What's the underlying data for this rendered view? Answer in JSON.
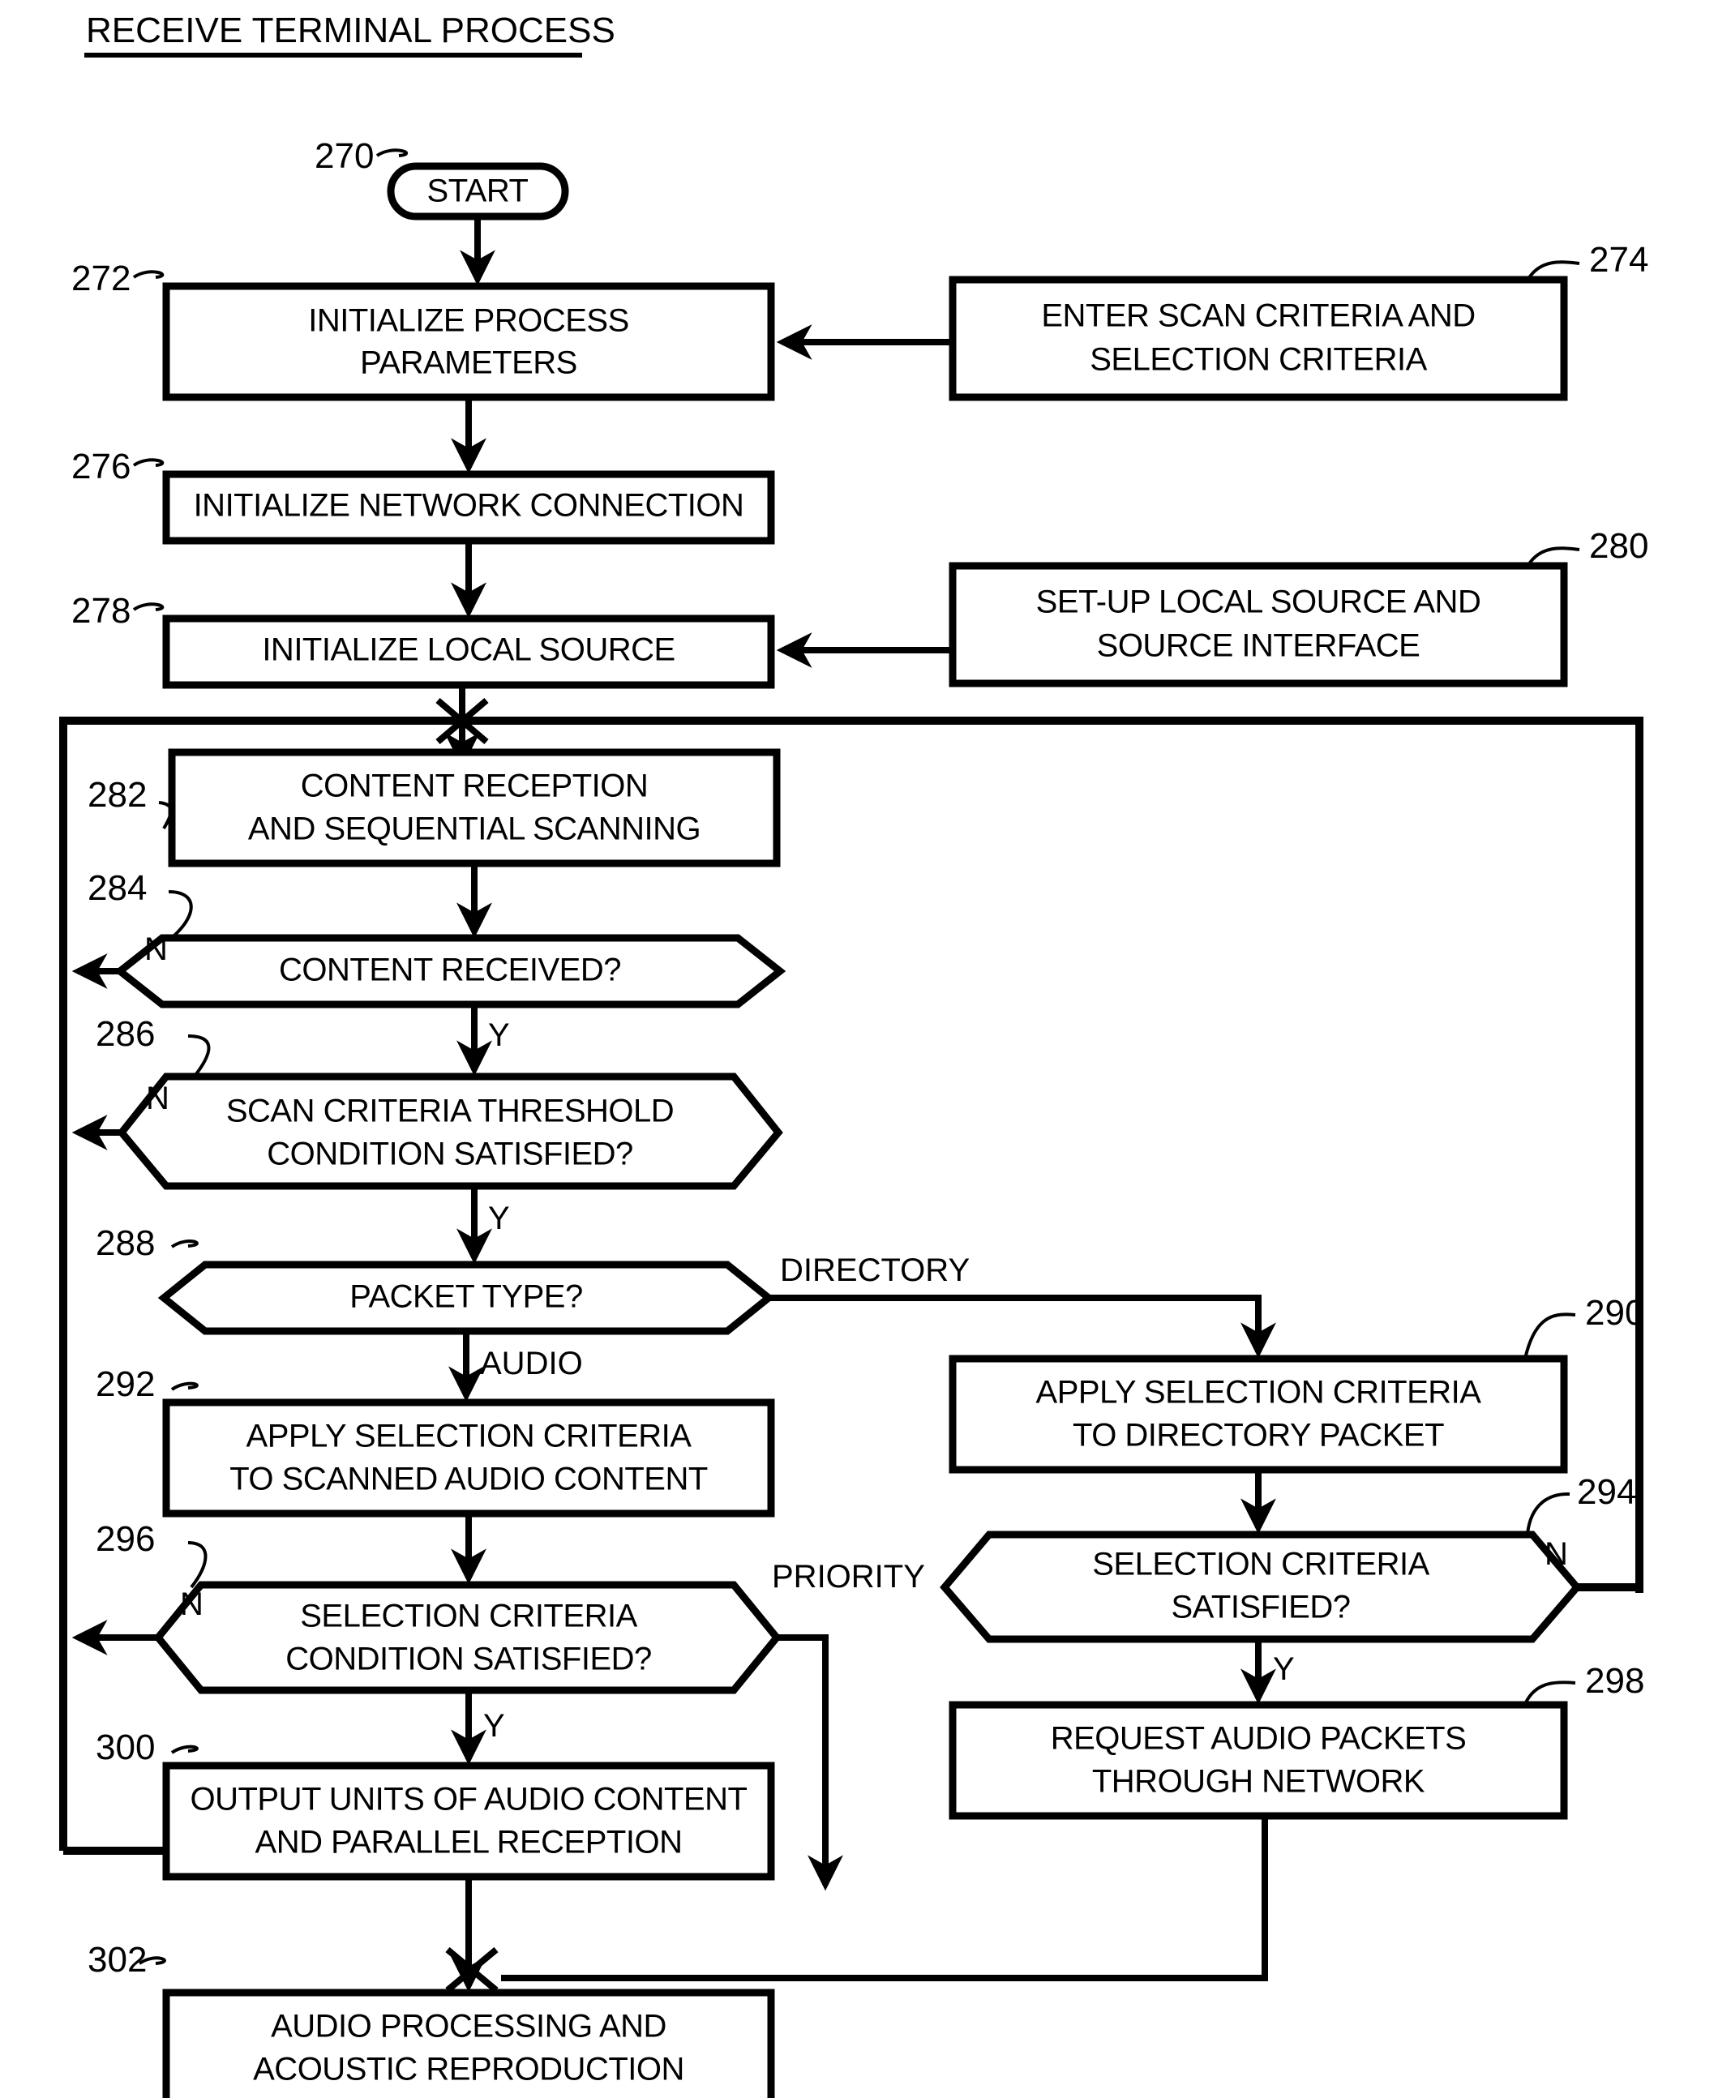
{
  "figure": {
    "title": "RECEIVE TERMINAL PROCESS"
  },
  "nodes": {
    "start": {
      "ref": "270",
      "label": "START",
      "shape": "terminator"
    },
    "n272": {
      "ref": "272",
      "line1": "INITIALIZE PROCESS",
      "line2": "PARAMETERS",
      "shape": "process"
    },
    "n274": {
      "ref": "274",
      "line1": "ENTER SCAN CRITERIA AND",
      "line2": "SELECTION CRITERIA",
      "shape": "process"
    },
    "n276": {
      "ref": "276",
      "line1": "INITIALIZE NETWORK CONNECTION",
      "line2": "",
      "shape": "process"
    },
    "n278": {
      "ref": "278",
      "line1": "INITIALIZE LOCAL SOURCE",
      "line2": "",
      "shape": "process"
    },
    "n280": {
      "ref": "280",
      "line1": "SET-UP LOCAL SOURCE AND",
      "line2": "SOURCE INTERFACE",
      "shape": "process"
    },
    "n282": {
      "ref": "282",
      "line1": "CONTENT RECEPTION",
      "line2": "AND SEQUENTIAL SCANNING",
      "shape": "process"
    },
    "n284": {
      "ref": "284",
      "line1": "CONTENT RECEIVED?",
      "line2": "",
      "shape": "decision"
    },
    "n286": {
      "ref": "286",
      "line1": "SCAN CRITERIA THRESHOLD",
      "line2": "CONDITION SATISFIED?",
      "shape": "decision"
    },
    "n288": {
      "ref": "288",
      "line1": "PACKET TYPE?",
      "line2": "",
      "shape": "decision"
    },
    "n290": {
      "ref": "290",
      "line1": "APPLY SELECTION CRITERIA",
      "line2": "TO DIRECTORY PACKET",
      "shape": "process"
    },
    "n292": {
      "ref": "292",
      "line1": "APPLY SELECTION CRITERIA",
      "line2": "TO SCANNED AUDIO CONTENT",
      "shape": "process"
    },
    "n294": {
      "ref": "294",
      "line1": "SELECTION CRITERIA",
      "line2": "SATISFIED?",
      "shape": "decision"
    },
    "n296": {
      "ref": "296",
      "line1": "SELECTION CRITERIA",
      "line2": "CONDITION SATISFIED?",
      "shape": "decision"
    },
    "n298": {
      "ref": "298",
      "line1": "REQUEST AUDIO PACKETS",
      "line2": "THROUGH NETWORK",
      "shape": "process"
    },
    "n300": {
      "ref": "300",
      "line1": "OUTPUT UNITS OF AUDIO CONTENT",
      "line2": "AND PARALLEL RECEPTION",
      "shape": "process"
    },
    "n302": {
      "ref": "302",
      "line1": "AUDIO PROCESSING AND",
      "line2": "ACOUSTIC REPRODUCTION",
      "shape": "process"
    }
  },
  "edge_labels": {
    "e284_no": "N",
    "e284_yes": "Y",
    "e286_no": "N",
    "e286_yes": "Y",
    "e288_directory": "DIRECTORY",
    "e288_audio": "AUDIO",
    "e294_no": "N",
    "e294_yes": "Y",
    "e296_no": "N",
    "e296_yes": "Y",
    "e296_priority": "PRIORITY"
  },
  "colors": {
    "ink": "#000000",
    "paper": "#ffffff"
  }
}
